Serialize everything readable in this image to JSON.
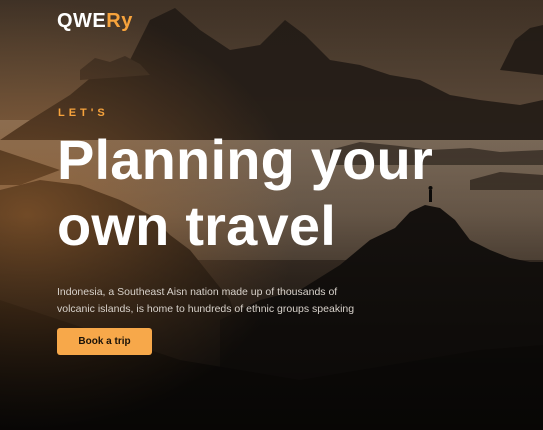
{
  "brand": {
    "logo_main": "QWE",
    "logo_accent": "Ry"
  },
  "hero": {
    "eyebrow": "LET'S",
    "title_line1": "Planning your",
    "title_line2": "own travel",
    "description": "Indonesia, a Southeast Aisn nation made up of thousands of volcanic islands, is home to hundreds of ethnic groups speaking",
    "cta_label": "Book a trip"
  },
  "colors": {
    "accent": "#f7a33c",
    "button_bg": "#f7a84a",
    "title_text": "#ffffff"
  }
}
